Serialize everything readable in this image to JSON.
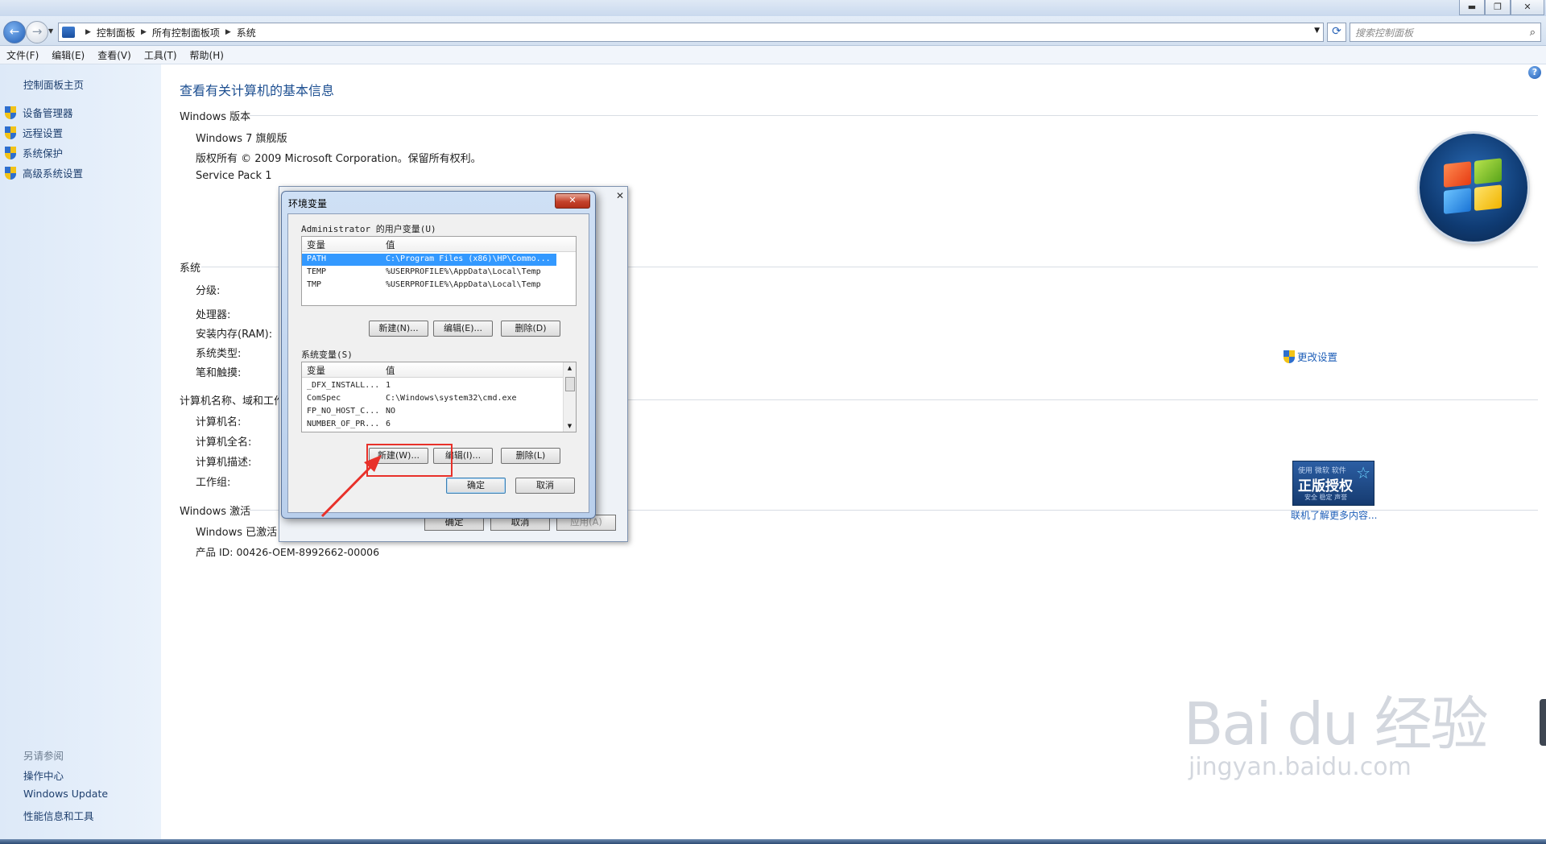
{
  "window": {
    "minimize_glyph": "▬",
    "maximize_glyph": "❐",
    "close_glyph": "✕"
  },
  "address": {
    "back_icon": "←",
    "fwd_icon": "→",
    "crumbs": [
      "控制面板",
      "所有控制面板项",
      "系统"
    ],
    "refresh_icon": "⟳",
    "search_placeholder": "搜索控制面板",
    "search_icon": "⌕"
  },
  "menu": [
    "文件(F)",
    "编辑(E)",
    "查看(V)",
    "工具(T)",
    "帮助(H)"
  ],
  "sidebar": {
    "home": "控制面板主页",
    "items": [
      "设备管理器",
      "远程设置",
      "系统保护",
      "高级系统设置"
    ],
    "see_also_title": "另请参阅",
    "see_also": [
      "操作中心",
      "Windows Update",
      "性能信息和工具"
    ]
  },
  "main": {
    "help_icon": "?",
    "title": "查看有关计算机的基本信息",
    "edition_header": "Windows 版本",
    "edition": "Windows 7 旗舰版",
    "copyright": "版权所有 © 2009 Microsoft Corporation。保留所有权利。",
    "service_pack": "Service Pack 1",
    "system_header": "系统",
    "system_rows": [
      "分级:",
      "处理器:",
      "安装内存(RAM):",
      "系统类型:",
      "笔和触摸:"
    ],
    "name_header": "计算机名称、域和工作组设置",
    "name_rows": [
      "计算机名:",
      "计算机全名:",
      "计算机描述:",
      "工作组:"
    ],
    "change_settings": "更改设置",
    "activation_header": "Windows 激活",
    "activated": "Windows 已激活",
    "product_id": "产品 ID: 00426-OEM-8992662-00006",
    "genuine_small": "使用 微软 软件",
    "genuine_big": "正版授权",
    "genuine_tag": "安全 稳定 声誉",
    "learn_more": "联机了解更多内容..."
  },
  "back_dialog": {
    "close_glyph": "✕",
    "ok": "确定",
    "cancel": "取消",
    "apply": "应用(A)"
  },
  "env_dialog": {
    "title": "环境变量",
    "close_glyph": "✕",
    "user_group": "Administrator 的用户变量(U)",
    "col_var": "变量",
    "col_val": "值",
    "user_vars": [
      {
        "name": "PATH",
        "value": "C:\\Program Files (x86)\\HP\\Commo..."
      },
      {
        "name": "TEMP",
        "value": "%USERPROFILE%\\AppData\\Local\\Temp"
      },
      {
        "name": "TMP",
        "value": "%USERPROFILE%\\AppData\\Local\\Temp"
      }
    ],
    "user_new": "新建(N)...",
    "user_edit": "编辑(E)...",
    "user_delete": "删除(D)",
    "sys_group": "系统变量(S)",
    "sys_vars": [
      {
        "name": "_DFX_INSTALL...",
        "value": "1"
      },
      {
        "name": "ComSpec",
        "value": "C:\\Windows\\system32\\cmd.exe"
      },
      {
        "name": "FP_NO_HOST_C...",
        "value": "NO"
      },
      {
        "name": "NUMBER_OF_PR...",
        "value": "6"
      }
    ],
    "sys_new": "新建(W)...",
    "sys_edit": "编辑(I)...",
    "sys_delete": "删除(L)",
    "ok": "确定",
    "cancel": "取消"
  },
  "watermark": {
    "line1": "Bai du 经验",
    "line2": "jingyan.baidu.com"
  },
  "colors": {
    "accent": "#1d4f91",
    "selection": "#3399ff",
    "highlight_box": "#e8312a"
  }
}
